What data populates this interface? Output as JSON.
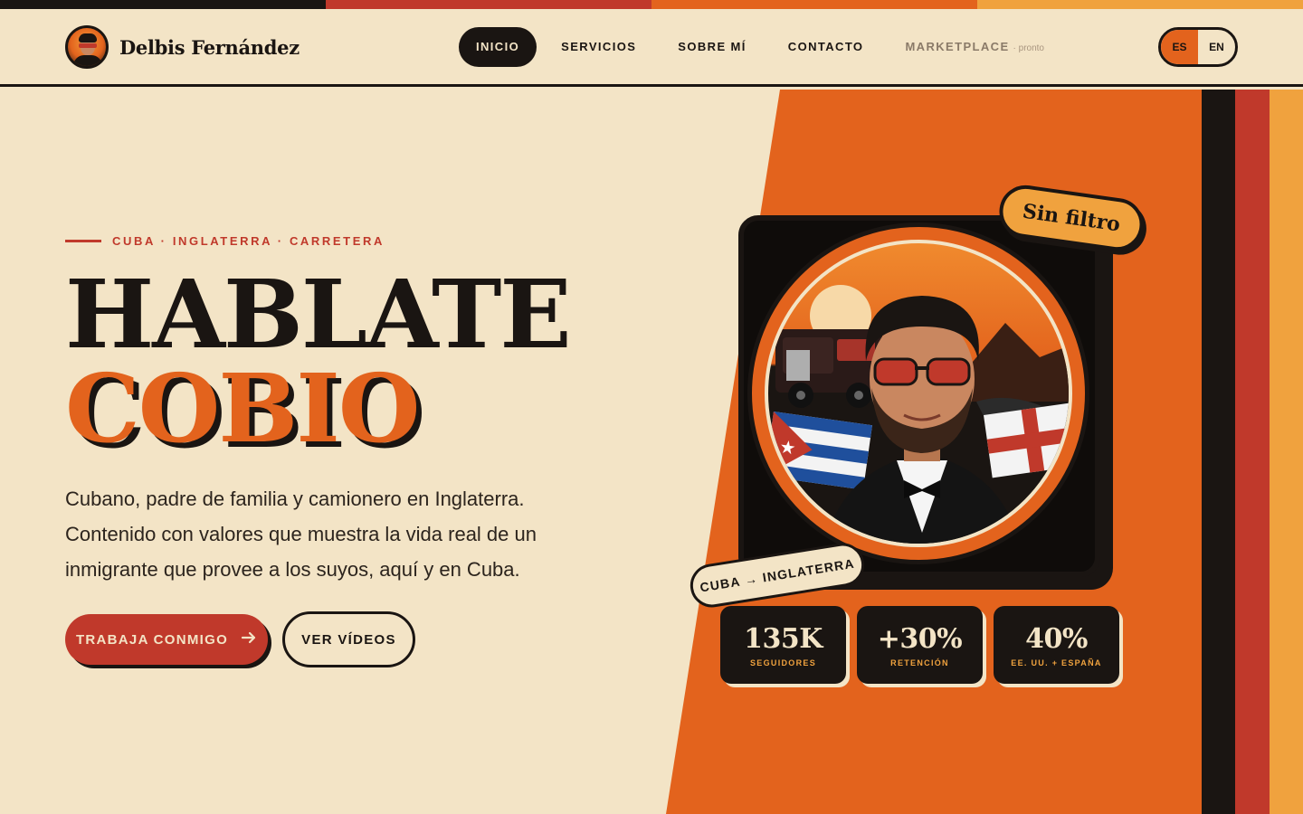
{
  "colors": {
    "cream": "#f3e4c6",
    "dark": "#1a1512",
    "red": "#c0392b",
    "orange": "#e3631d",
    "amber": "#f0a23e"
  },
  "top_stripe_colors": [
    "#1a1512",
    "#c0392b",
    "#e3631d",
    "#f0a23e"
  ],
  "brand": {
    "name": "Delbis Fernández"
  },
  "nav": {
    "items": [
      {
        "label": "INICIO",
        "active": true
      },
      {
        "label": "SERVICIOS"
      },
      {
        "label": "SOBRE MÍ"
      },
      {
        "label": "CONTACTO"
      },
      {
        "label": "MARKETPLACE",
        "badge": "· pronto"
      }
    ]
  },
  "lang": {
    "es": "ES",
    "en": "EN",
    "active": "ES"
  },
  "hero": {
    "kicker": "CUBA · INGLATERRA · CARRETERA",
    "title_line1": "HABLATE",
    "title_line2": "COBIO",
    "lead": "Cubano, padre de familia y camionero en Inglaterra. Contenido con valores que muestra la vida real de un inmigrante que provee a los suyos, aquí y en Cuba.",
    "cta_primary": "TRABAJA CONMIGO",
    "cta_primary_icon": "arrow-right-icon",
    "cta_secondary": "VER VÍDEOS"
  },
  "card": {
    "sticker_top": "Sin filtro",
    "sticker_bottom": "CUBA → INGLATERRA"
  },
  "stats": [
    {
      "value": "135K",
      "label": "SEGUIDORES"
    },
    {
      "value": "+30%",
      "label": "RETENCIÓN"
    },
    {
      "value": "40%",
      "label": "EE. UU. + ESPAÑA"
    }
  ]
}
